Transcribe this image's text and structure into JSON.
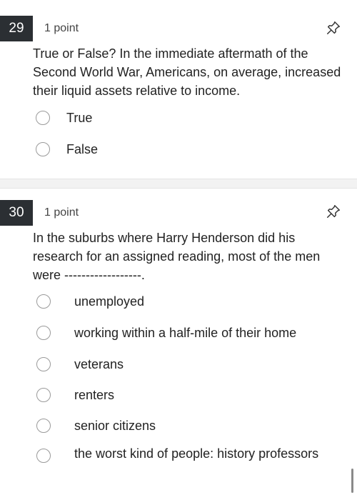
{
  "q29": {
    "number": "29",
    "points": "1 point",
    "text": "True or False? In the immediate aftermath of the Second World War, Americans, on average, increased their liquid assets relative to income.",
    "options": [
      "True",
      "False"
    ]
  },
  "q30": {
    "number": "30",
    "points": "1 point",
    "text": "In the suburbs where Harry Henderson did his research for an assigned reading, most of the men were ------------------.",
    "options": [
      "unemployed",
      "working within a half-mile of their home",
      "veterans",
      "renters",
      "senior citizens",
      "the worst kind of people: history professors"
    ]
  },
  "icons": {
    "pin": "pin-icon",
    "radio": "radio-unchecked"
  }
}
